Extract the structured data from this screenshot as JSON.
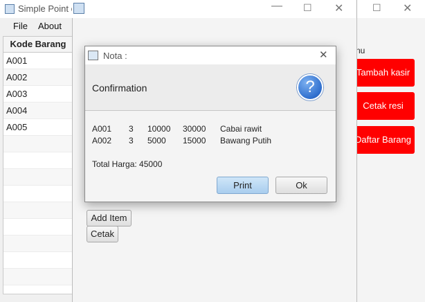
{
  "main_window": {
    "title": "Simple Point o",
    "menu": [
      "File",
      "About"
    ]
  },
  "table": {
    "header": "Kode Barang",
    "rows": [
      "A001",
      "A002",
      "A003",
      "A004",
      "A005"
    ]
  },
  "right_panel": {
    "label": "nu",
    "buttons": [
      "Tambah kasir",
      "Cetak resi",
      "Daftar Barang"
    ]
  },
  "form": {
    "add_item": "Add Item",
    "cetak": "Cetak"
  },
  "dialog": {
    "title": "Nota :",
    "header": "Confirmation",
    "lines": [
      {
        "kode": "A001",
        "qty": "3",
        "harga": "10000",
        "subtotal": "30000",
        "nama": "Cabai rawit"
      },
      {
        "kode": "A002",
        "qty": "3",
        "harga": "5000",
        "subtotal": "15000",
        "nama": "Bawang Putih"
      }
    ],
    "total": "Total Harga: 45000",
    "print_label": "Print",
    "ok_label": "Ok"
  },
  "colors": {
    "accent_red": "#ff0000",
    "print_button": "#b5d6f2",
    "question_icon": "#2f6fce"
  }
}
